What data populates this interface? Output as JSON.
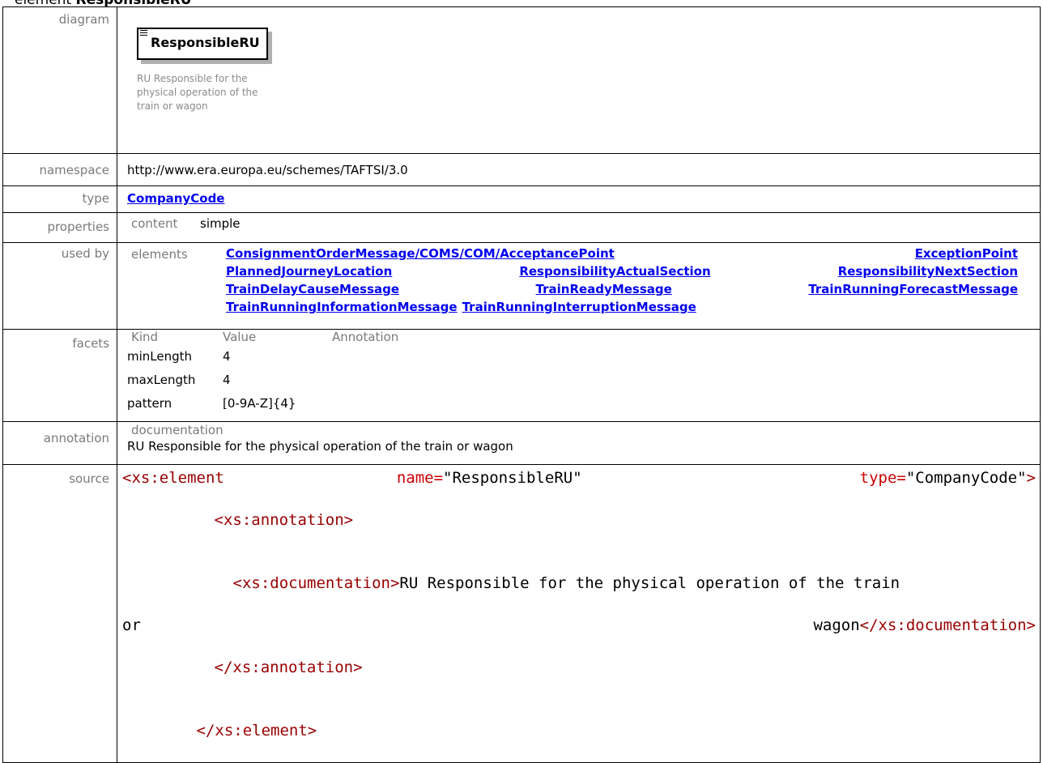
{
  "heading": {
    "prefix": "element",
    "name": "ResponsibleRU"
  },
  "labels": {
    "diagram": "diagram",
    "namespace": "namespace",
    "type": "type",
    "properties": "properties",
    "used_by": "used by",
    "facets": "facets",
    "annotation": "annotation",
    "source": "source"
  },
  "diagram": {
    "element_name": "ResponsibleRU",
    "documentation": "RU Responsible for the physical operation of the train or wagon"
  },
  "namespace": "http://www.era.europa.eu/schemes/TAFTSI/3.0",
  "type_link": "CompanyCode",
  "properties": {
    "key": "content",
    "value": "simple"
  },
  "used_by": {
    "key": "elements",
    "links": [
      "ConsignmentOrderMessage/COMS/COM/AcceptancePoint",
      "ExceptionPoint",
      "PlannedJourneyLocation",
      "ResponsibilityActualSection",
      "ResponsibilityNextSection",
      "TrainDelayCauseMessage",
      "TrainReadyMessage",
      "TrainRunningForecastMessage",
      "TrainRunningInformationMessage",
      "TrainRunningInterruptionMessage"
    ]
  },
  "facets": {
    "headers": [
      "Kind",
      "Value",
      "Annotation"
    ],
    "rows": [
      {
        "kind": "minLength",
        "value": "4"
      },
      {
        "kind": "maxLength",
        "value": "4"
      },
      {
        "kind": "pattern",
        "value": "[0-9A-Z]{4}"
      }
    ]
  },
  "annotation": {
    "key": "documentation",
    "text": "RU Responsible for the physical operation of the train or wagon"
  },
  "source": {
    "l1_open": "<xs:element",
    "l1_name_attr": "name=",
    "l1_name_val": "\"ResponsibleRU\"",
    "l1_type_attr": "type=",
    "l1_type_val": "\"CompanyCode\"",
    "l1_close": ">",
    "l2": "<xs:annotation>",
    "l3_open": "<xs:documentation>",
    "l3_text": "RU Responsible for the physical operation of the train",
    "l4_text_a": "or",
    "l4_text_b": "wagon",
    "l4_close": "</xs:documentation>",
    "l5": "</xs:annotation>",
    "l6": "</xs:element>"
  },
  "colors": {
    "link": "#0000ee",
    "label": "#7a7a7a",
    "tag": "#990000",
    "attr": "#cc0000"
  }
}
